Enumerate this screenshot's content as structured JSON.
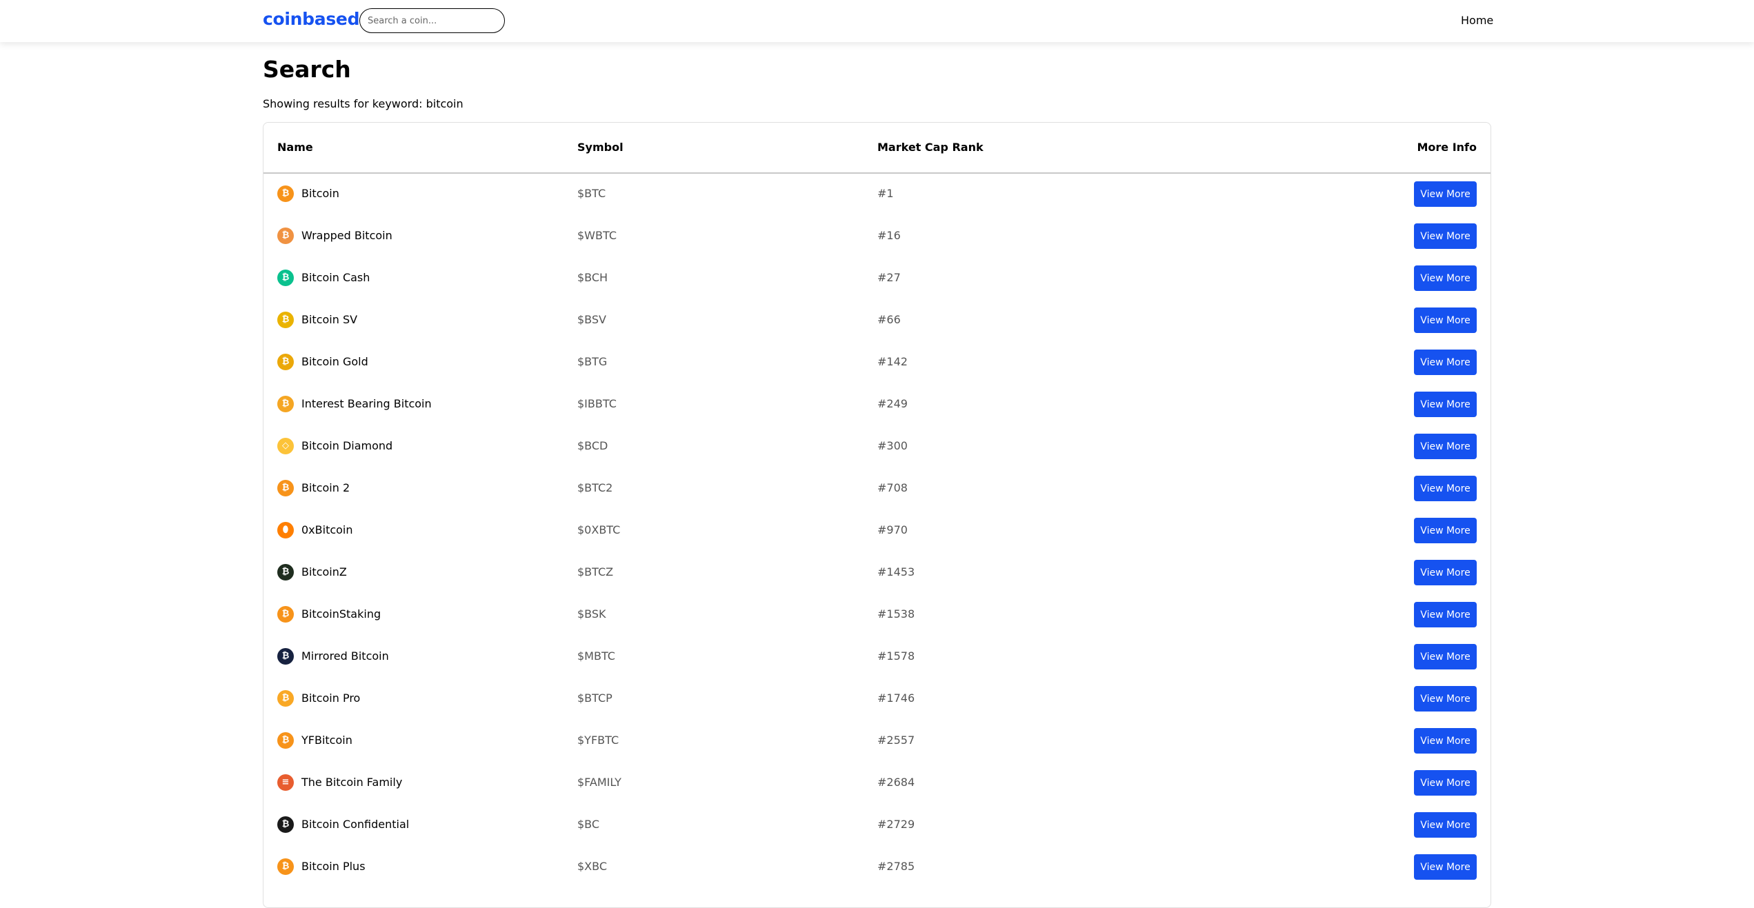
{
  "brand": "coinbased",
  "search": {
    "placeholder": "Search a coin..."
  },
  "nav": {
    "home": "Home"
  },
  "page": {
    "title": "Search",
    "subtitle": "Showing results for keyword: bitcoin"
  },
  "table": {
    "headers": {
      "name": "Name",
      "symbol": "Symbol",
      "rank": "Market Cap Rank",
      "more": "More Info"
    },
    "button_label": "View More",
    "rows": [
      {
        "name": "Bitcoin",
        "symbol": "$BTC",
        "rank": "#1",
        "icon": "bitcoin-icon",
        "color": "#f7931a",
        "glyph": "₿"
      },
      {
        "name": "Wrapped Bitcoin",
        "symbol": "$WBTC",
        "rank": "#16",
        "icon": "wrapped-bitcoin-icon",
        "color": "#f09242",
        "glyph": "₿"
      },
      {
        "name": "Bitcoin Cash",
        "symbol": "$BCH",
        "rank": "#27",
        "icon": "bitcoin-cash-icon",
        "color": "#0ac18e",
        "glyph": "₿"
      },
      {
        "name": "Bitcoin SV",
        "symbol": "$BSV",
        "rank": "#66",
        "icon": "bitcoin-sv-icon",
        "color": "#eab300",
        "glyph": "₿"
      },
      {
        "name": "Bitcoin Gold",
        "symbol": "$BTG",
        "rank": "#142",
        "icon": "bitcoin-gold-icon",
        "color": "#eba809",
        "glyph": "₿"
      },
      {
        "name": "Interest Bearing Bitcoin",
        "symbol": "$IBBTC",
        "rank": "#249",
        "icon": "interest-bearing-bitcoin-icon",
        "color": "#f5a623",
        "glyph": "₿"
      },
      {
        "name": "Bitcoin Diamond",
        "symbol": "$BCD",
        "rank": "#300",
        "icon": "bitcoin-diamond-icon",
        "color": "#fcc339",
        "glyph": "◇"
      },
      {
        "name": "Bitcoin 2",
        "symbol": "$BTC2",
        "rank": "#708",
        "icon": "bitcoin-2-icon",
        "color": "#f7931a",
        "glyph": "₿"
      },
      {
        "name": "0xBitcoin",
        "symbol": "$0XBTC",
        "rank": "#970",
        "icon": "0xbitcoin-icon",
        "color": "#ff7f00",
        "glyph": "⬮"
      },
      {
        "name": "BitcoinZ",
        "symbol": "$BTCZ",
        "rank": "#1453",
        "icon": "bitcoinz-icon",
        "color": "#1f2d1f",
        "glyph": "₿"
      },
      {
        "name": "BitcoinStaking",
        "symbol": "$BSK",
        "rank": "#1538",
        "icon": "bitcoinstaking-icon",
        "color": "#f7931a",
        "glyph": "₿"
      },
      {
        "name": "Mirrored Bitcoin",
        "symbol": "$MBTC",
        "rank": "#1578",
        "icon": "mirrored-bitcoin-icon",
        "color": "#172240",
        "glyph": "₿"
      },
      {
        "name": "Bitcoin Pro",
        "symbol": "$BTCP",
        "rank": "#1746",
        "icon": "bitcoin-pro-icon",
        "color": "#f9a825",
        "glyph": "₿"
      },
      {
        "name": "YFBitcoin",
        "symbol": "$YFBTC",
        "rank": "#2557",
        "icon": "yfbitcoin-icon",
        "color": "#f7931a",
        "glyph": "₿"
      },
      {
        "name": "The Bitcoin Family",
        "symbol": "$FAMILY",
        "rank": "#2684",
        "icon": "the-bitcoin-family-icon",
        "color": "#e85d2f",
        "glyph": "≡"
      },
      {
        "name": "Bitcoin Confidential",
        "symbol": "$BC",
        "rank": "#2729",
        "icon": "bitcoin-confidential-icon",
        "color": "#1a1a1a",
        "glyph": "₿"
      },
      {
        "name": "Bitcoin Plus",
        "symbol": "$XBC",
        "rank": "#2785",
        "icon": "bitcoin-plus-icon",
        "color": "#f7931a",
        "glyph": "₿"
      }
    ]
  }
}
